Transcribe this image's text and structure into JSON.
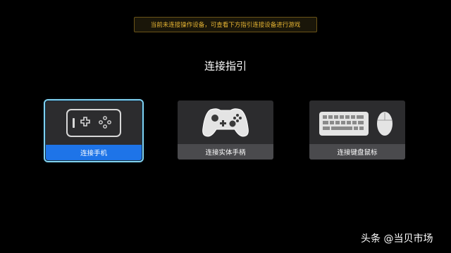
{
  "notice": "当前未连接操作设备，可查看下方指引连接设备进行游戏",
  "title": "连接指引",
  "cards": [
    {
      "label": "连接手机",
      "icon": "phone-controller-icon",
      "selected": true
    },
    {
      "label": "连接实体手柄",
      "icon": "gamepad-icon",
      "selected": false
    },
    {
      "label": "连接键盘鼠标",
      "icon": "keyboard-mouse-icon",
      "selected": false
    }
  ],
  "watermark": "头条 @当贝市场",
  "colors": {
    "background": "#000000",
    "notice_text": "#e7b533",
    "selected_label_bg": "#1e74e8",
    "card_bg": "#2c2c2e",
    "label_bg": "#4a4a4d",
    "focus_outline": "#7fd1f0"
  }
}
